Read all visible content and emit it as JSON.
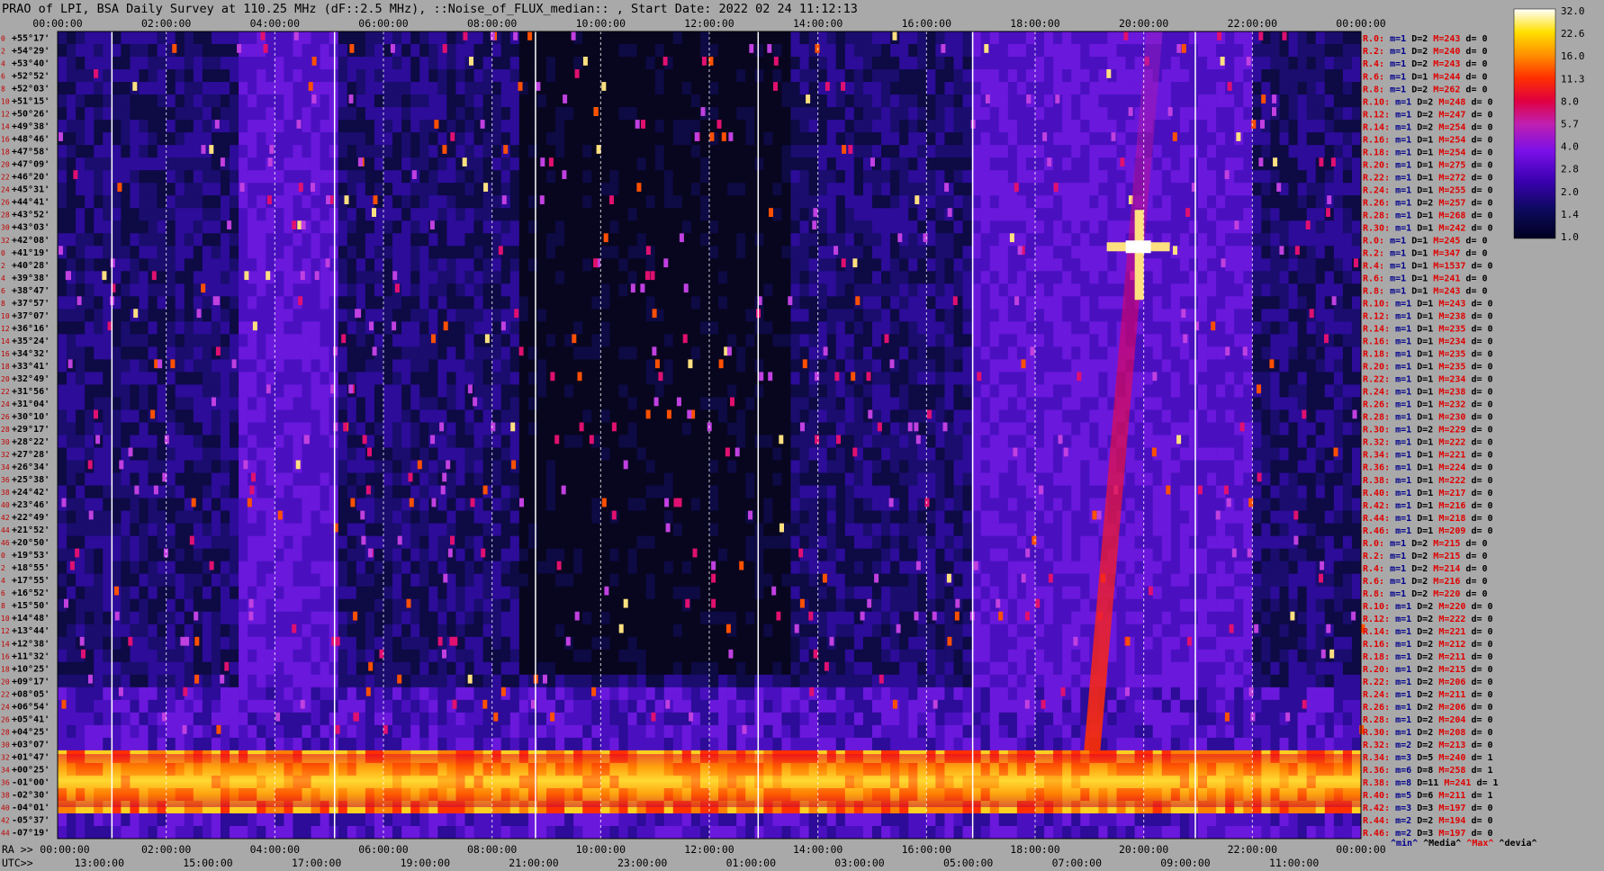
{
  "title": "PRAO of LPI, BSA Daily Survey at 110.25 MHz (dF::2.5 MHz), ::Noise_of_FLUX_median:: , Start Date: 2022 02 24 11:12:13",
  "top_axis": [
    "00:00:00",
    "02:00:00",
    "04:00:00",
    "06:00:00",
    "08:00:00",
    "10:00:00",
    "12:00:00",
    "14:00:00",
    "16:00:00",
    "18:00:00",
    "20:00:00",
    "22:00:00",
    "00:00:00"
  ],
  "bottom_ra_label": "RA >>",
  "bottom_ra": [
    "00:00:00",
    "02:00:00",
    "04:00:00",
    "06:00:00",
    "08:00:00",
    "10:00:00",
    "12:00:00",
    "14:00:00",
    "16:00:00",
    "18:00:00",
    "20:00:00",
    "22:00:00",
    "00:00:00"
  ],
  "bottom_utc_label": "UTC>>",
  "bottom_utc": [
    "13:00:00",
    "15:00:00",
    "17:00:00",
    "19:00:00",
    "21:00:00",
    "23:00:00",
    "01:00:00",
    "03:00:00",
    "05:00:00",
    "07:00:00",
    "09:00:00",
    "11:00:00"
  ],
  "declinations": [
    "+55°17'",
    "+54°29'",
    "+53°40'",
    "+52°52'",
    "+52°03'",
    "+51°15'",
    "+50°26'",
    "+49°38'",
    "+48°46'",
    "+47°58'",
    "+47°09'",
    "+46°20'",
    "+45°31'",
    "+44°41'",
    "+43°52'",
    "+43°03'",
    "+42°08'",
    "+41°19'",
    "+40°28'",
    "+39°38'",
    "+38°47'",
    "+37°57'",
    "+37°07'",
    "+36°16'",
    "+35°24'",
    "+34°32'",
    "+33°41'",
    "+32°49'",
    "+31°56'",
    "+31°04'",
    "+30°10'",
    "+29°17'",
    "+28°22'",
    "+27°28'",
    "+26°34'",
    "+25°38'",
    "+24°42'",
    "+23°46'",
    "+22°49'",
    "+21°52'",
    "+20°50'",
    "+19°53'",
    "+18°55'",
    "+17°55'",
    "+16°52'",
    "+15°50'",
    "+14°48'",
    "+13°44'",
    "+12°38'",
    "+11°32'",
    "+10°25'",
    "+09°17'",
    "+08°05'",
    "+06°54'",
    "+05°41'",
    "+04°25'",
    "+03°07'",
    "+01°47'",
    "+00°25'",
    "-01°00'",
    "-02°30'",
    "-04°01'",
    "-05°37'",
    "-07°19'"
  ],
  "row_numbers": [
    "0",
    "2",
    "4",
    "6",
    "8",
    "10",
    "12",
    "14",
    "16",
    "18",
    "20",
    "22",
    "24",
    "26",
    "28",
    "30",
    "32",
    "0",
    "2",
    "4",
    "6",
    "8",
    "10",
    "12",
    "14",
    "16",
    "18",
    "20",
    "22",
    "24",
    "26",
    "28",
    "30",
    "32",
    "34",
    "36",
    "38",
    "40",
    "42",
    "44",
    "46",
    "0",
    "2",
    "4",
    "6",
    "8",
    "10",
    "12",
    "14",
    "16",
    "18",
    "20",
    "22",
    "24",
    "26",
    "28",
    "30",
    "32",
    "34",
    "36",
    "38",
    "40",
    "42",
    "44"
  ],
  "row_stats": [
    {
      "r": "R.0:",
      "m": "m=1",
      "d": "D=2",
      "mx": "M=243",
      "dv": "d= 0"
    },
    {
      "r": "R.2:",
      "m": "m=1",
      "d": "D=2",
      "mx": "M=240",
      "dv": "d= 0"
    },
    {
      "r": "R.4:",
      "m": "m=1",
      "d": "D=2",
      "mx": "M=243",
      "dv": "d= 0"
    },
    {
      "r": "R.6:",
      "m": "m=1",
      "d": "D=1",
      "mx": "M=244",
      "dv": "d= 0"
    },
    {
      "r": "R.8:",
      "m": "m=1",
      "d": "D=2",
      "mx": "M=262",
      "dv": "d= 0"
    },
    {
      "r": "R.10:",
      "m": "m=1",
      "d": "D=2",
      "mx": "M=248",
      "dv": "d= 0"
    },
    {
      "r": "R.12:",
      "m": "m=1",
      "d": "D=2",
      "mx": "M=247",
      "dv": "d= 0"
    },
    {
      "r": "R.14:",
      "m": "m=1",
      "d": "D=2",
      "mx": "M=254",
      "dv": "d= 0"
    },
    {
      "r": "R.16:",
      "m": "m=1",
      "d": "D=1",
      "mx": "M=254",
      "dv": "d= 0"
    },
    {
      "r": "R.18:",
      "m": "m=1",
      "d": "D=1",
      "mx": "M=254",
      "dv": "d= 0"
    },
    {
      "r": "R.20:",
      "m": "m=1",
      "d": "D=1",
      "mx": "M=275",
      "dv": "d= 0"
    },
    {
      "r": "R.22:",
      "m": "m=1",
      "d": "D=1",
      "mx": "M=272",
      "dv": "d= 0"
    },
    {
      "r": "R.24:",
      "m": "m=1",
      "d": "D=1",
      "mx": "M=255",
      "dv": "d= 0"
    },
    {
      "r": "R.26:",
      "m": "m=1",
      "d": "D=2",
      "mx": "M=257",
      "dv": "d= 0"
    },
    {
      "r": "R.28:",
      "m": "m=1",
      "d": "D=1",
      "mx": "M=268",
      "dv": "d= 0"
    },
    {
      "r": "R.30:",
      "m": "m=1",
      "d": "D=1",
      "mx": "M=242",
      "dv": "d= 0"
    },
    {
      "r": "R.0:",
      "m": "m=1",
      "d": "D=1",
      "mx": "M=245",
      "dv": "d= 0"
    },
    {
      "r": "R.2:",
      "m": "m=1",
      "d": "D=1",
      "mx": "M=347",
      "dv": "d= 0"
    },
    {
      "r": "R.4:",
      "m": "m=1",
      "d": "D=1",
      "mx": "M=1537",
      "dv": "d= 0"
    },
    {
      "r": "R.6:",
      "m": "m=1",
      "d": "D=1",
      "mx": "M=241",
      "dv": "d= 0"
    },
    {
      "r": "R.8:",
      "m": "m=1",
      "d": "D=1",
      "mx": "M=243",
      "dv": "d= 0"
    },
    {
      "r": "R.10:",
      "m": "m=1",
      "d": "D=1",
      "mx": "M=243",
      "dv": "d= 0"
    },
    {
      "r": "R.12:",
      "m": "m=1",
      "d": "D=1",
      "mx": "M=238",
      "dv": "d= 0"
    },
    {
      "r": "R.14:",
      "m": "m=1",
      "d": "D=1",
      "mx": "M=235",
      "dv": "d= 0"
    },
    {
      "r": "R.16:",
      "m": "m=1",
      "d": "D=1",
      "mx": "M=234",
      "dv": "d= 0"
    },
    {
      "r": "R.18:",
      "m": "m=1",
      "d": "D=1",
      "mx": "M=235",
      "dv": "d= 0"
    },
    {
      "r": "R.20:",
      "m": "m=1",
      "d": "D=1",
      "mx": "M=235",
      "dv": "d= 0"
    },
    {
      "r": "R.22:",
      "m": "m=1",
      "d": "D=1",
      "mx": "M=234",
      "dv": "d= 0"
    },
    {
      "r": "R.24:",
      "m": "m=1",
      "d": "D=1",
      "mx": "M=238",
      "dv": "d= 0"
    },
    {
      "r": "R.26:",
      "m": "m=1",
      "d": "D=1",
      "mx": "M=232",
      "dv": "d= 0"
    },
    {
      "r": "R.28:",
      "m": "m=1",
      "d": "D=1",
      "mx": "M=230",
      "dv": "d= 0"
    },
    {
      "r": "R.30:",
      "m": "m=1",
      "d": "D=2",
      "mx": "M=229",
      "dv": "d= 0"
    },
    {
      "r": "R.32:",
      "m": "m=1",
      "d": "D=1",
      "mx": "M=222",
      "dv": "d= 0"
    },
    {
      "r": "R.34:",
      "m": "m=1",
      "d": "D=1",
      "mx": "M=221",
      "dv": "d= 0"
    },
    {
      "r": "R.36:",
      "m": "m=1",
      "d": "D=1",
      "mx": "M=224",
      "dv": "d= 0"
    },
    {
      "r": "R.38:",
      "m": "m=1",
      "d": "D=1",
      "mx": "M=222",
      "dv": "d= 0"
    },
    {
      "r": "R.40:",
      "m": "m=1",
      "d": "D=1",
      "mx": "M=217",
      "dv": "d= 0"
    },
    {
      "r": "R.42:",
      "m": "m=1",
      "d": "D=1",
      "mx": "M=216",
      "dv": "d= 0"
    },
    {
      "r": "R.44:",
      "m": "m=1",
      "d": "D=1",
      "mx": "M=218",
      "dv": "d= 0"
    },
    {
      "r": "R.46:",
      "m": "m=1",
      "d": "D=1",
      "mx": "M=209",
      "dv": "d= 0"
    },
    {
      "r": "R.0:",
      "m": "m=1",
      "d": "D=2",
      "mx": "M=215",
      "dv": "d= 0"
    },
    {
      "r": "R.2:",
      "m": "m=1",
      "d": "D=2",
      "mx": "M=215",
      "dv": "d= 0"
    },
    {
      "r": "R.4:",
      "m": "m=1",
      "d": "D=2",
      "mx": "M=214",
      "dv": "d= 0"
    },
    {
      "r": "R.6:",
      "m": "m=1",
      "d": "D=2",
      "mx": "M=216",
      "dv": "d= 0"
    },
    {
      "r": "R.8:",
      "m": "m=1",
      "d": "D=2",
      "mx": "M=220",
      "dv": "d= 0"
    },
    {
      "r": "R.10:",
      "m": "m=1",
      "d": "D=2",
      "mx": "M=220",
      "dv": "d= 0"
    },
    {
      "r": "R.12:",
      "m": "m=1",
      "d": "D=2",
      "mx": "M=222",
      "dv": "d= 0"
    },
    {
      "r": "R.14:",
      "m": "m=1",
      "d": "D=2",
      "mx": "M=221",
      "dv": "d= 0"
    },
    {
      "r": "R.16:",
      "m": "m=1",
      "d": "D=2",
      "mx": "M=212",
      "dv": "d= 0"
    },
    {
      "r": "R.18:",
      "m": "m=1",
      "d": "D=2",
      "mx": "M=211",
      "dv": "d= 0"
    },
    {
      "r": "R.20:",
      "m": "m=1",
      "d": "D=2",
      "mx": "M=215",
      "dv": "d= 0"
    },
    {
      "r": "R.22:",
      "m": "m=1",
      "d": "D=2",
      "mx": "M=206",
      "dv": "d= 0"
    },
    {
      "r": "R.24:",
      "m": "m=1",
      "d": "D=2",
      "mx": "M=211",
      "dv": "d= 0"
    },
    {
      "r": "R.26:",
      "m": "m=1",
      "d": "D=2",
      "mx": "M=206",
      "dv": "d= 0"
    },
    {
      "r": "R.28:",
      "m": "m=1",
      "d": "D=2",
      "mx": "M=204",
      "dv": "d= 0"
    },
    {
      "r": "R.30:",
      "m": "m=1",
      "d": "D=2",
      "mx": "M=208",
      "dv": "d= 0"
    },
    {
      "r": "R.32:",
      "m": "m=2",
      "d": "D=2",
      "mx": "M=213",
      "dv": "d= 0"
    },
    {
      "r": "R.34:",
      "m": "m=3",
      "d": "D=5",
      "mx": "M=240",
      "dv": "d= 1"
    },
    {
      "r": "R.36:",
      "m": "m=6",
      "d": "D=8",
      "mx": "M=258",
      "dv": "d= 1"
    },
    {
      "r": "R.38:",
      "m": "m=8",
      "d": "D=11",
      "mx": "M=241",
      "dv": "d= 1"
    },
    {
      "r": "R.40:",
      "m": "m=5",
      "d": "D=6",
      "mx": "M=211",
      "dv": "d= 1"
    },
    {
      "r": "R.42:",
      "m": "m=3",
      "d": "D=3",
      "mx": "M=197",
      "dv": "d= 0"
    },
    {
      "r": "R.44:",
      "m": "m=2",
      "d": "D=2",
      "mx": "M=194",
      "dv": "d= 0"
    },
    {
      "r": "R.46:",
      "m": "m=2",
      "d": "D=3",
      "mx": "M=197",
      "dv": "d= 0"
    }
  ],
  "stat_legend": {
    "min": "^min^",
    "median": "^Media^",
    "max": "^Max^",
    "dev": "^devia^"
  },
  "colorbar_ticks": [
    "32.0",
    "22.6",
    "16.0",
    "11.3",
    "8.0",
    "5.7",
    "4.0",
    "2.8",
    "2.0",
    "1.4",
    "1.0"
  ],
  "colors": {
    "background": "#a9a9a9",
    "min": "#00008b",
    "median": "#000000",
    "max": "#e00000",
    "dev": "#000000"
  },
  "chart_data": {
    "type": "heatmap",
    "title": "PRAO of LPI, BSA Daily Survey at 110.25 MHz (dF::2.5 MHz), ::Noise_of_FLUX_median:: , Start Date: 2022 02 24 11:12:13",
    "x_axis": "RA 00:00:00 to 24:00:00 (top and bottom), UTC 11:12 to 11:12 next day",
    "y_axis": "Declination, 64 beams from +55°17' to -07°19'",
    "colorscale": "log, 1.0 to 32.0",
    "features": [
      {
        "type": "bright-band",
        "rows": "+01°47' to -02°30'",
        "ra_hours": [
          0,
          24
        ],
        "level": 16
      },
      {
        "type": "dark-region",
        "ra_hours": [
          8.5,
          13.5
        ],
        "rows": "+55°17' to +10°25'",
        "level": 1.0
      },
      {
        "type": "point-source",
        "ra_hours": 19.9,
        "dec": "+41°19'",
        "level": 32
      },
      {
        "type": "diagonal-streak",
        "ra_hours": [
          18.8,
          20.5
        ],
        "rows": "+01°47' to +55°17'",
        "level": 8
      }
    ]
  }
}
